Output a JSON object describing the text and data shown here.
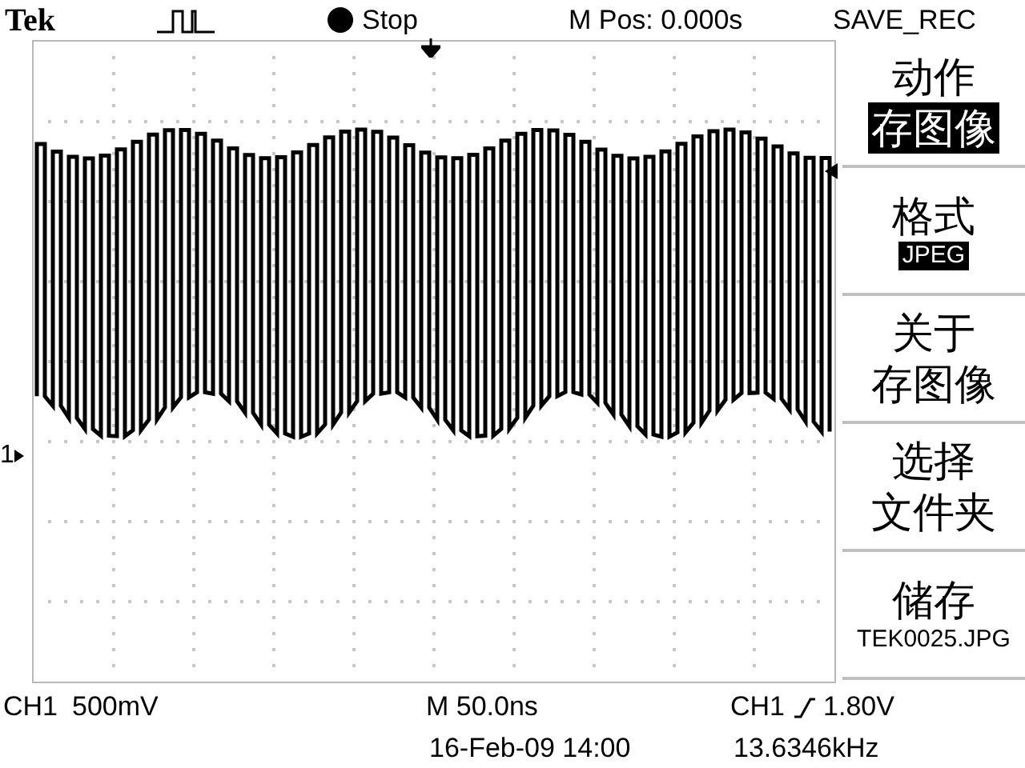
{
  "top_bar": {
    "brand": "Tek",
    "run_state": "Stop",
    "position": "M Pos: 0.000s",
    "menu_title": "SAVE_REC"
  },
  "channel_marker": "1",
  "menu": {
    "items": [
      {
        "lines": [
          {
            "text": "动作",
            "kind": "large",
            "highlighted": false
          },
          {
            "text": "存图像",
            "kind": "large",
            "highlighted": true
          }
        ]
      },
      {
        "lines": [
          {
            "text": "格式",
            "kind": "large",
            "highlighted": false
          },
          {
            "text": "JPEG",
            "kind": "small",
            "highlighted": true
          }
        ]
      },
      {
        "lines": [
          {
            "text": "关于",
            "kind": "large",
            "highlighted": false
          },
          {
            "text": "存图像",
            "kind": "large",
            "highlighted": false
          }
        ]
      },
      {
        "lines": [
          {
            "text": "选择",
            "kind": "large",
            "highlighted": false
          },
          {
            "text": "文件夹",
            "kind": "large",
            "highlighted": false
          }
        ]
      },
      {
        "lines": [
          {
            "text": "储存",
            "kind": "large",
            "highlighted": false
          },
          {
            "text": "TEK0025.JPG",
            "kind": "small",
            "highlighted": false
          }
        ]
      }
    ]
  },
  "status": {
    "channel": "CH1",
    "scale": "500mV",
    "timebase": "M 50.0ns",
    "trigger_channel": "CH1",
    "trigger_level": "1.80V",
    "date": "16-Feb-09 14:00",
    "frequency": "13.6346kHz"
  }
}
